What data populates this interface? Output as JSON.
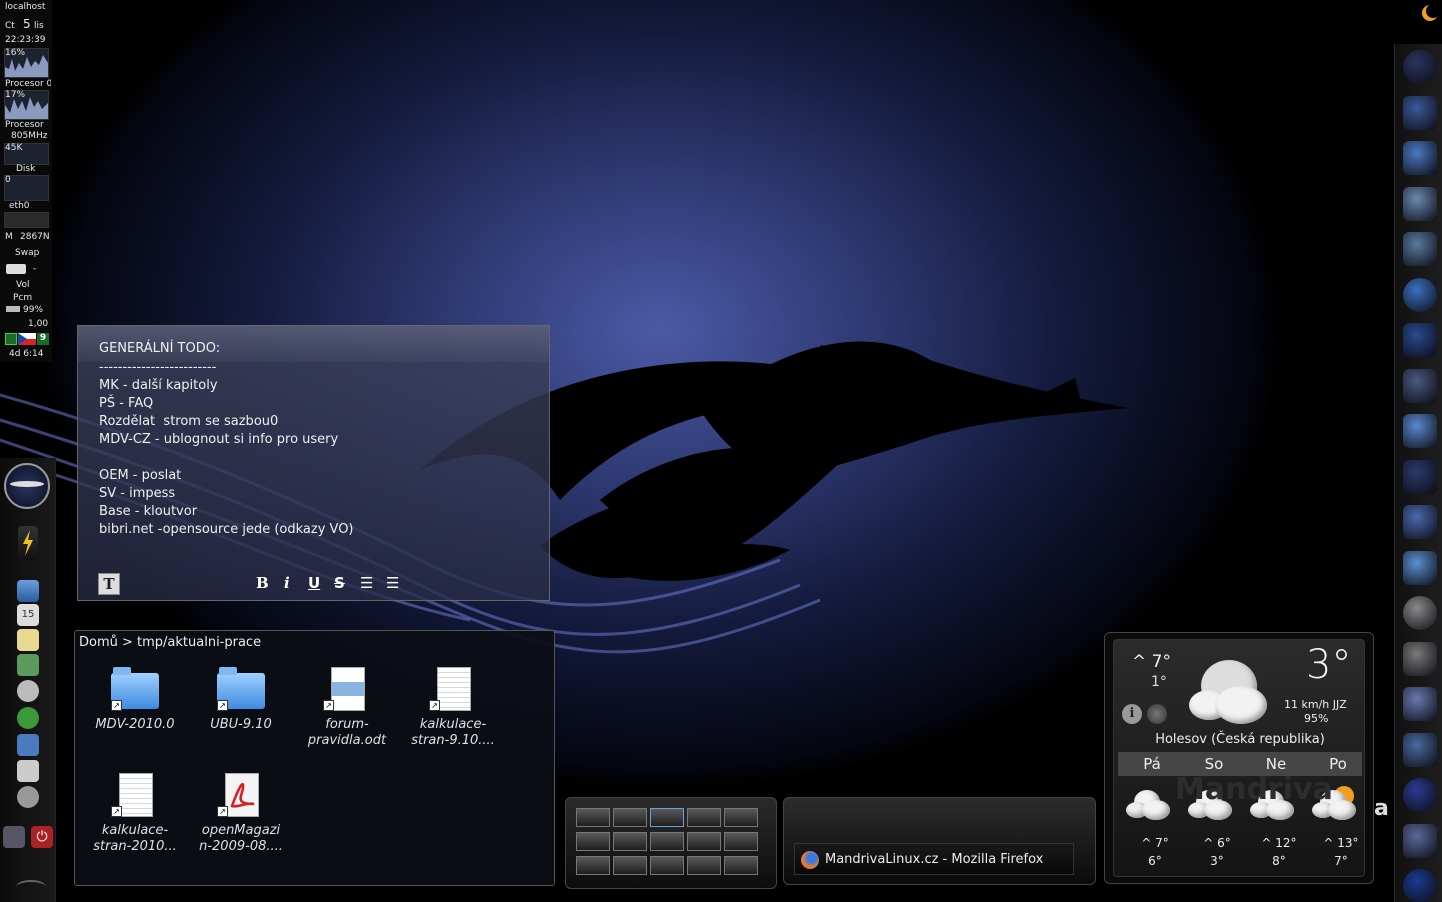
{
  "sysmon": {
    "host": "localhost",
    "date_day": "Čt",
    "date_num": "5",
    "date_mon": "lis",
    "time": "22:23:39",
    "cpu1_pct": "16%",
    "cpu1_label": "Procesor 0",
    "cpu2_pct": "17%",
    "cpu2_label": "Procesor",
    "freq": "805MHz",
    "disk_val": "45K",
    "disk_label": "Disk",
    "net_val": "0",
    "net_label": "eth0",
    "mem_label": "M",
    "mem_val": "2867N",
    "swap_label": "Swap",
    "mail_val": "-",
    "vol_label": "Vol",
    "pcm_label": "Pcm",
    "battery_pct": "99%",
    "load_val": "1,00",
    "kbd_count": "9",
    "uptime": "4d 6:14"
  },
  "note": {
    "title": "GENERÁLNÍ TODO:",
    "lines": [
      "-------------------------",
      "MK - další kapitoly",
      "PŠ - FAQ",
      "Rozdělat  strom se sazbou0",
      "MDV-CZ - ublognout si info pro usery",
      "",
      "OEM - poslat",
      "SV - impess",
      "Base - kloutvor",
      "bibri.net -opensource jede (odkazy VO)"
    ],
    "tools": {
      "t": "T",
      "bold": "B",
      "italic": "i",
      "underline": "U",
      "strike": "S",
      "list1": "☰",
      "list2": "☰"
    }
  },
  "folderview": {
    "breadcrumb": "Domů > tmp/aktualni-prace",
    "items": [
      {
        "l1": "MDV-2010.0",
        "l2": "",
        "kind": "folder"
      },
      {
        "l1": "UBU-9.10",
        "l2": "",
        "kind": "folder"
      },
      {
        "l1": "forum-",
        "l2": "pravidla.odt",
        "kind": "doc"
      },
      {
        "l1": "kalkulace-",
        "l2": "stran-9.10....",
        "kind": "sheet"
      },
      {
        "l1": "kalkulace-",
        "l2": "stran-2010...",
        "kind": "sheet"
      },
      {
        "l1": "openMagazi",
        "l2": "n-2009-08....",
        "kind": "pdf"
      }
    ]
  },
  "taskbar": {
    "task_label": "MandrivaLinux.cz - Mozilla Firefox"
  },
  "weather": {
    "hi": "^ 7°",
    "lo": "1°",
    "current": "3°",
    "wind": "11 km/h JJZ",
    "humidity": "95%",
    "location": "Holesov (Česká republika)",
    "days": [
      {
        "name": "Pá",
        "hi": "^ 7°",
        "lo": "6°"
      },
      {
        "name": "So",
        "hi": "^ 6°",
        "lo": "3°"
      },
      {
        "name": "Ne",
        "hi": "^ 12°",
        "lo": "8°"
      },
      {
        "name": "Po",
        "hi": "^ 13°",
        "lo": "7°"
      }
    ]
  },
  "brand": {
    "watermark_char": "a"
  }
}
